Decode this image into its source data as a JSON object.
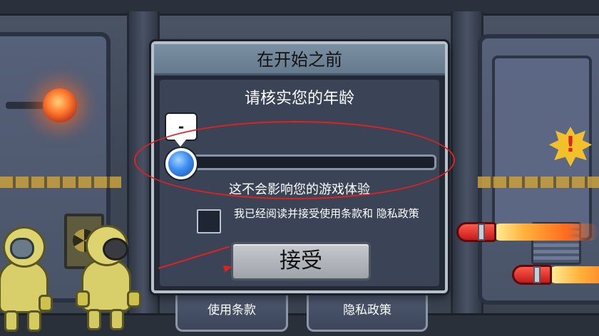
{
  "dialog": {
    "title": "在开始之前",
    "subtitle": "请核实您的年龄",
    "age_value": "-",
    "age_slider_fraction": 0.0,
    "note": "这不会影响您的游戏体验",
    "checkbox_label": "我已经阅读并接受使用条款和 隐私政策",
    "checkbox_checked": false,
    "accept_label": "接受"
  },
  "footer": {
    "terms_label": "使用条款",
    "privacy_label": "隐私政策"
  },
  "scene": {
    "warning_symbol": "!"
  },
  "colors": {
    "annotation_red": "#e0211d",
    "header_bg": "#6f8397",
    "slider_thumb": "#3a8ef0",
    "warning_yellow": "#f2c02a"
  },
  "icons": [
    "warning-icon",
    "radiation-icon",
    "slider-thumb",
    "rocket-icon"
  ]
}
